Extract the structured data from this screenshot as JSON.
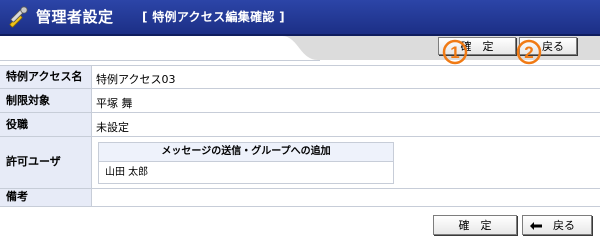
{
  "header": {
    "title": "管理者設定",
    "subtitle": "[ 特例アクセス編集確認 ]"
  },
  "top_buttons": {
    "confirm_label": "確　定",
    "back_label": "戻る",
    "marker_1": "1",
    "marker_2": "2"
  },
  "fields": {
    "special_access_name": {
      "label": "特例アクセス名",
      "value": "特例アクセス03"
    },
    "restriction_target": {
      "label": "制限対象",
      "value": "平塚 舞"
    },
    "position": {
      "label": "役職",
      "value": "未設定"
    },
    "allowed_users": {
      "label": "許可ユーザ",
      "table_header": "メッセージの送信・グループへの追加",
      "table_value": "山田 太郎"
    },
    "notes": {
      "label": "備考",
      "value": ""
    }
  },
  "bottom_buttons": {
    "confirm_label": "確　定",
    "back_label": "戻る"
  },
  "colors": {
    "header_bg": "#1f3491",
    "label_bg": "#e7ebf7",
    "marker_orange": "#f07a14"
  }
}
